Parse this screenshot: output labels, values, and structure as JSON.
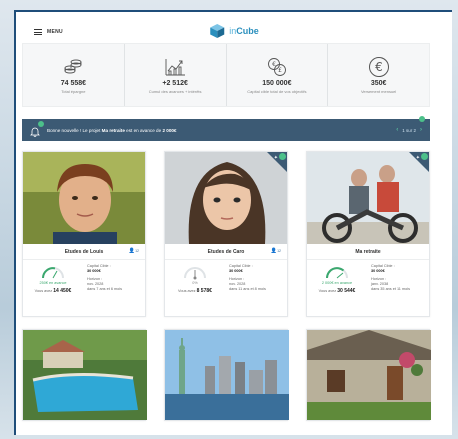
{
  "header": {
    "menu_label": "MENU",
    "logo_prefix": "in",
    "logo_suffix": "Cube"
  },
  "stats": [
    {
      "icon": "coins-icon",
      "value": "74 558€",
      "label": "Total épargne"
    },
    {
      "icon": "growth-chart-icon",
      "value": "+2 512€",
      "label": "Cumul des avances + intérêts"
    },
    {
      "icon": "money-exchange-icon",
      "value": "150 000€",
      "label": "Capital cible total de vos objectifs"
    },
    {
      "icon": "euro-icon",
      "value": "350€",
      "label": "Versement mensuel"
    }
  ],
  "banner": {
    "prefix": "Bonne nouvelle ! Le projet ",
    "project": "Ma retraite",
    "middle": " est en avance de ",
    "amount": "2 000€",
    "pager": "1 sur 2"
  },
  "cards": [
    {
      "title": "Etudes de Louis",
      "status": "250€ en avance",
      "total_label": "Vous avez",
      "total_value": "14 450€",
      "target_label": "Capital Cible :",
      "target_value": "30 000€",
      "horizon_label": "Horizon :",
      "horizon_date": "nov. 2028",
      "horizon_rest": "dans 7 ans et 6 mois"
    },
    {
      "title": "Etudes de Caro",
      "status": "0%",
      "total_label": "Vous avez",
      "total_value": "8 578€",
      "target_label": "Capital Cible :",
      "target_value": "30 000€",
      "horizon_label": "Horizon :",
      "horizon_date": "nov. 2028",
      "horizon_rest": "dans 11 ans et 8 mois"
    },
    {
      "title": "Ma retraite",
      "status": "2 000€ en avance",
      "total_label": "Vous avez",
      "total_value": "30 544€",
      "target_label": "Capital Cible :",
      "target_value": "30 000€",
      "horizon_label": "Horizon :",
      "horizon_date": "janv. 2038",
      "horizon_rest": "dans 35 ans et 11 mois"
    }
  ],
  "colors": {
    "brand": "#2a8fbd",
    "banner": "#3c5a74",
    "accent_green": "#4cc08a"
  }
}
